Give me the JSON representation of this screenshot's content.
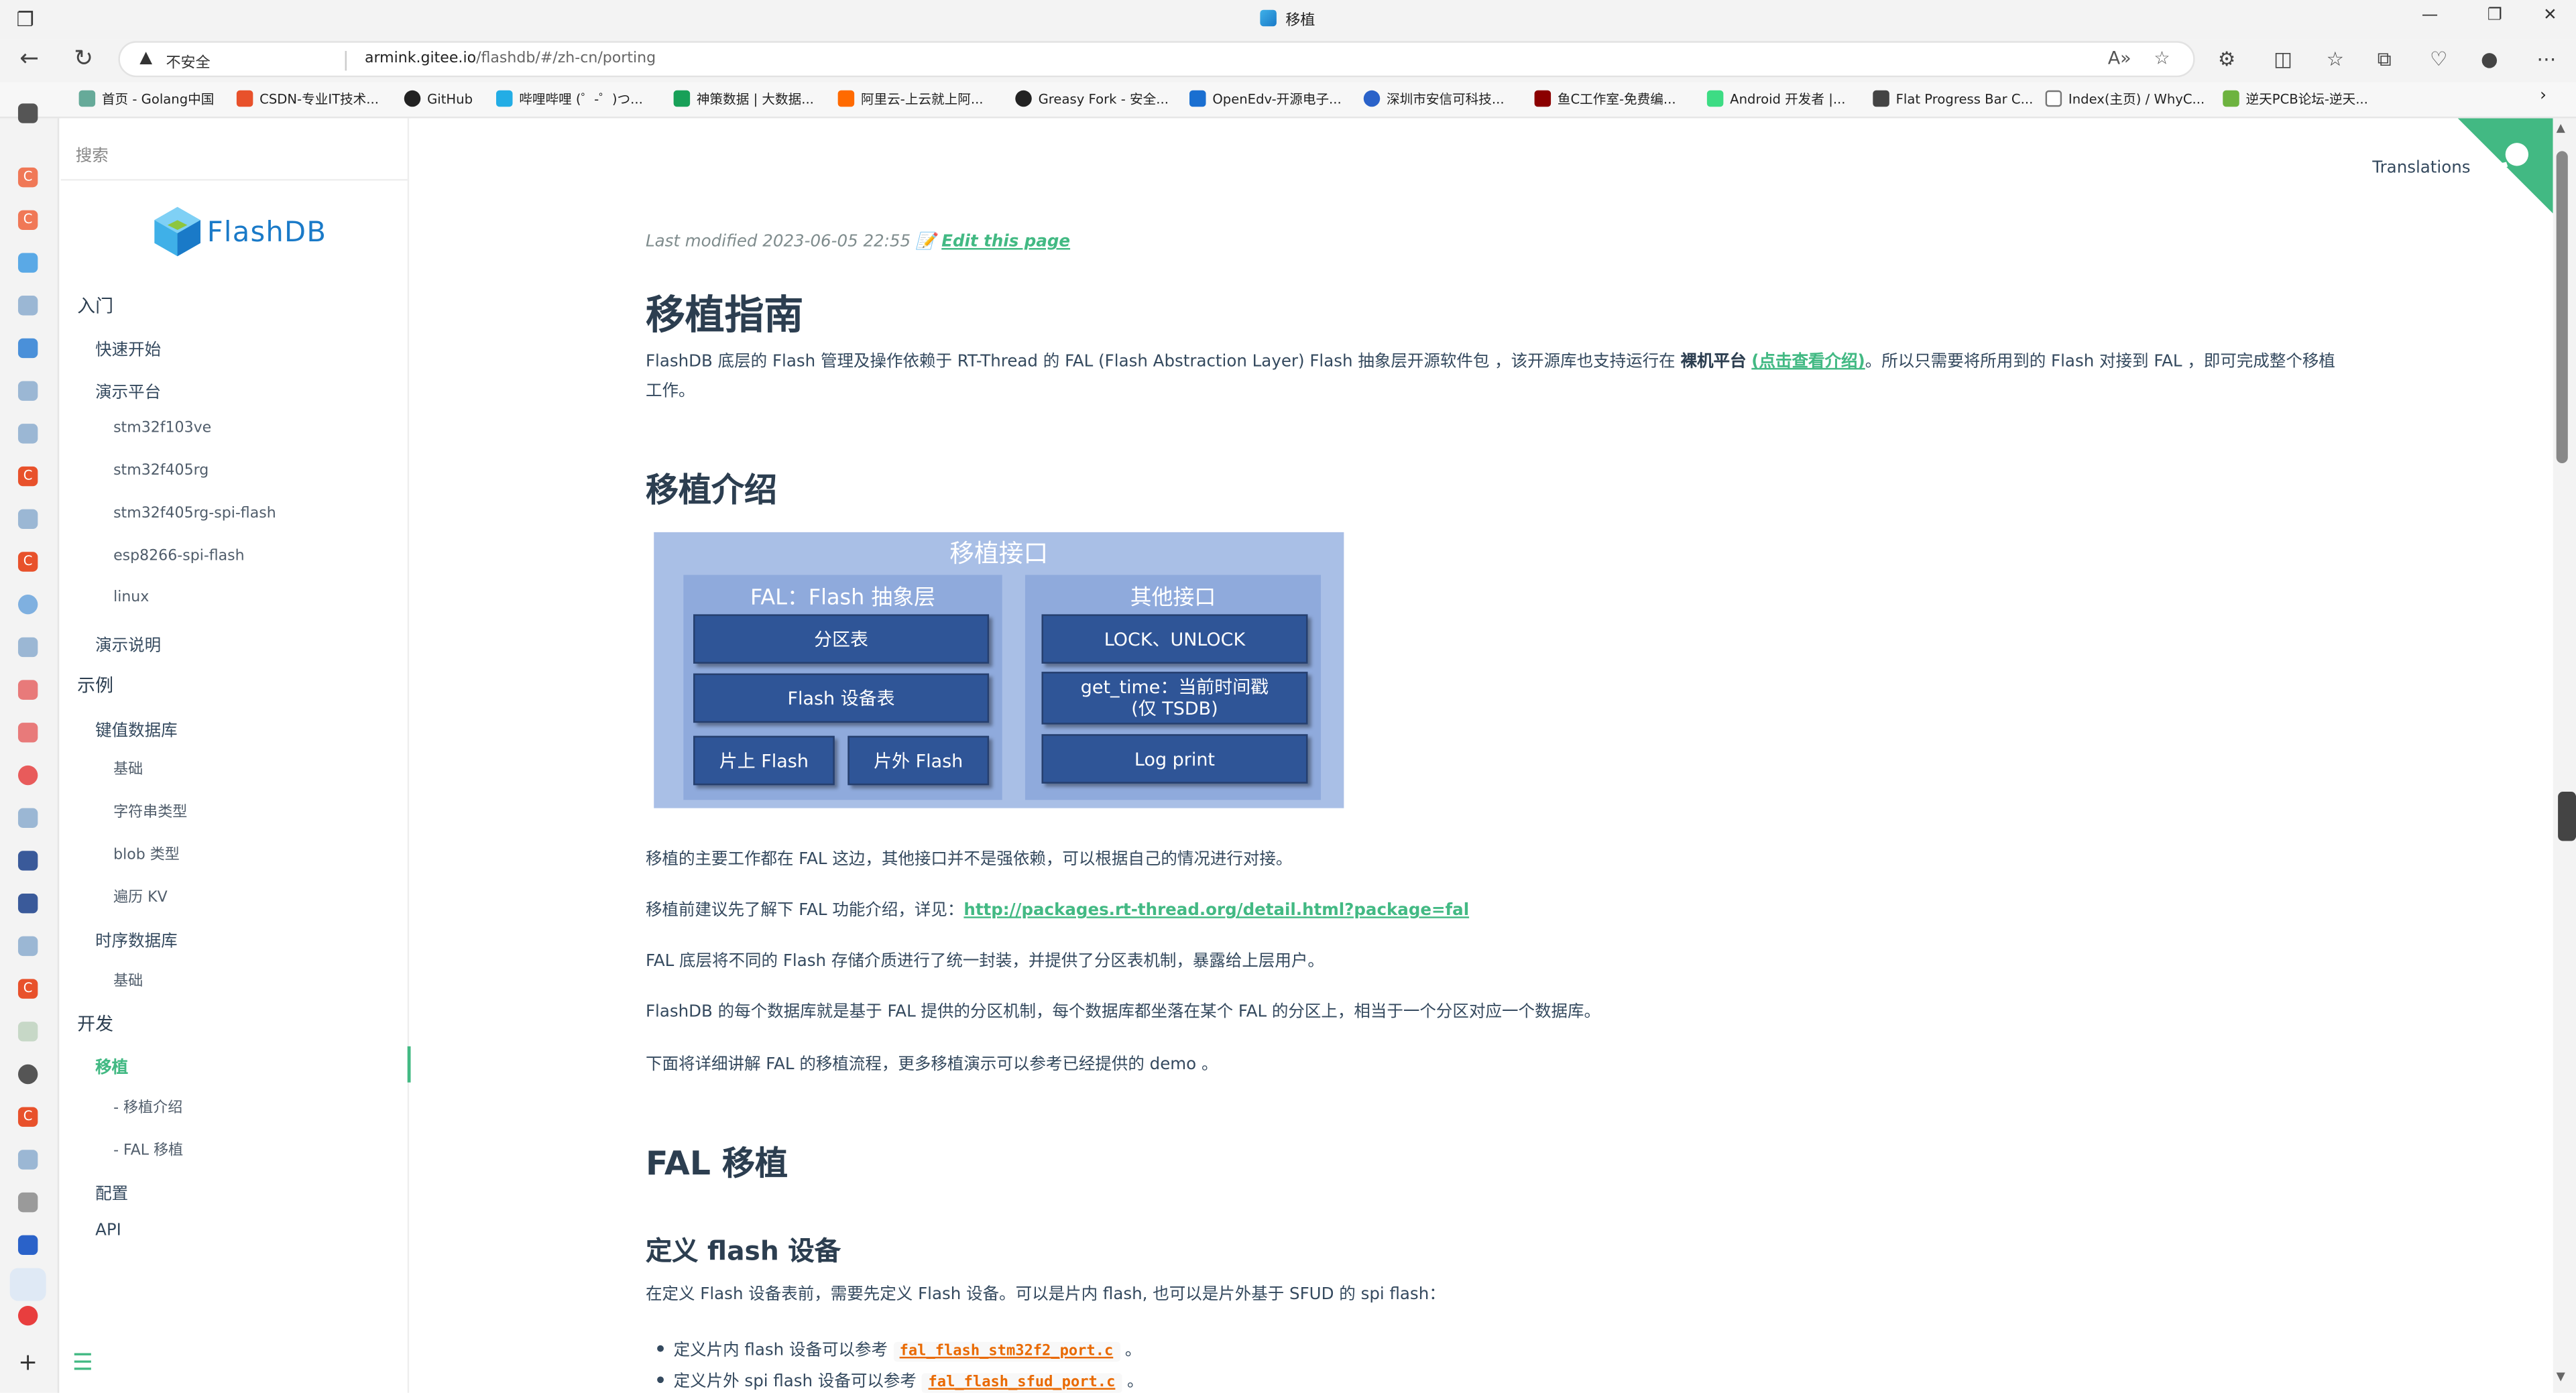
{
  "browser": {
    "tab_title": "移植",
    "security_label": "不安全",
    "url_host": "armink.gitee.io",
    "url_path": "/flashdb/#/zh-cn/porting"
  },
  "bookmarks": [
    {
      "label": "首页 - Golang中国",
      "color": "#6a9"
    },
    {
      "label": "CSDN-专业IT技术...",
      "color": "#e8512b"
    },
    {
      "label": "GitHub",
      "color": "#222"
    },
    {
      "label": "哔哩哔哩 (゜-゜)つ...",
      "color": "#23ade5"
    },
    {
      "label": "神策数据 | 大数据...",
      "color": "#18a058"
    },
    {
      "label": "阿里云-上云就上阿...",
      "color": "#ff6a00"
    },
    {
      "label": "Greasy Fork - 安全...",
      "color": "#222"
    },
    {
      "label": "OpenEdv-开源电子...",
      "color": "#1a6fd1"
    },
    {
      "label": "深圳市安信可科技...",
      "color": "#2a62c9"
    },
    {
      "label": "鱼C工作室-免费编...",
      "color": "#8b0000"
    },
    {
      "label": "Android 开发者 |...",
      "color": "#3ddc84"
    },
    {
      "label": "Flat Progress Bar C...",
      "color": "#444"
    },
    {
      "label": "Index(主页) / WhyC...",
      "color": "#777"
    },
    {
      "label": "逆天PCB论坛-逆天...",
      "color": "#6db33f"
    }
  ],
  "sidebar": {
    "search_placeholder": "搜索",
    "logo_text": "FlashDB",
    "items": [
      {
        "label": "入门",
        "level": 1
      },
      {
        "label": "快速开始",
        "level": 2
      },
      {
        "label": "演示平台",
        "level": 2
      },
      {
        "label": "stm32f103ve",
        "level": 3
      },
      {
        "label": "stm32f405rg",
        "level": 3
      },
      {
        "label": "stm32f405rg-spi-flash",
        "level": 3
      },
      {
        "label": "esp8266-spi-flash",
        "level": 3
      },
      {
        "label": "linux",
        "level": 3
      },
      {
        "label": "演示说明",
        "level": 2
      },
      {
        "label": "示例",
        "level": 1
      },
      {
        "label": "键值数据库",
        "level": 2
      },
      {
        "label": "基础",
        "level": 3
      },
      {
        "label": "字符串类型",
        "level": 3
      },
      {
        "label": "blob 类型",
        "level": 3
      },
      {
        "label": "遍历 KV",
        "level": 3
      },
      {
        "label": "时序数据库",
        "level": 2
      },
      {
        "label": "基础",
        "level": 3
      },
      {
        "label": "开发",
        "level": 1
      },
      {
        "label": "移植",
        "level": 2,
        "active": true
      },
      {
        "label": "- 移植介绍",
        "level": 3
      },
      {
        "label": "- FAL 移植",
        "level": 3
      },
      {
        "label": "配置",
        "level": 2
      },
      {
        "label": "API",
        "level": 2
      }
    ]
  },
  "content": {
    "translations": "Translations",
    "last_modified": "Last modified 2023-06-05 22:55",
    "edit_link": "Edit this page",
    "title": "移植指南",
    "intro_a": "FlashDB 底层的 Flash 管理及操作依赖于 RT-Thread 的 FAL (Flash Abstraction Layer) Flash 抽象层开源软件包 ，该开源库也支持运行在 ",
    "intro_bold": "裸机平台",
    "intro_link": "(点击查看介绍)",
    "intro_b": "。所以只需要将所用到的 Flash 对接到 FAL ，即可完成整个移植工作。",
    "h2_intro": "移植介绍",
    "diagram": {
      "title": "移植接口",
      "left_panel": "FAL：Flash 抽象层",
      "right_panel": "其他接口",
      "box_partition": "分区表",
      "box_flash_dev": "Flash 设备表",
      "box_onchip": "片上 Flash",
      "box_offchip": "片外 Flash",
      "box_lock": "LOCK、UNLOCK",
      "box_time_1": "get_time：当前时间戳",
      "box_time_2": "(仅 TSDB)",
      "box_log": "Log print"
    },
    "p1": "移植的主要工作都在 FAL 这边，其他接口并不是强依赖，可以根据自己的情况进行对接。",
    "p2_a": "移植前建议先了解下 FAL 功能介绍，详见：",
    "p2_link": "http://packages.rt-thread.org/detail.html?package=fal",
    "p3": "FAL 底层将不同的 Flash 存储介质进行了统一封装，并提供了分区表机制，暴露给上层用户。",
    "p4": "FlashDB 的每个数据库就是基于 FAL 提供的分区机制，每个数据库都坐落在某个 FAL 的分区上，相当于一个分区对应一个数据库。",
    "p5": "下面将详细讲解 FAL 的移植流程，更多移植演示可以参考已经提供的 demo 。",
    "h2_fal": "FAL 移植",
    "h3_define": "定义 flash 设备",
    "p6": "在定义 Flash 设备表前，需要先定义 Flash 设备。可以是片内 flash, 也可以是片外基于 SFUD 的 spi flash：",
    "li1_text": "定义片内 flash 设备可以参考",
    "li1_code": "fal_flash_stm32f2_port.c",
    "li1_end": "。",
    "li2_text": "定义片外 spi flash 设备可以参考",
    "li2_code": "fal_flash_sfud_port.c",
    "li2_end": "。"
  }
}
